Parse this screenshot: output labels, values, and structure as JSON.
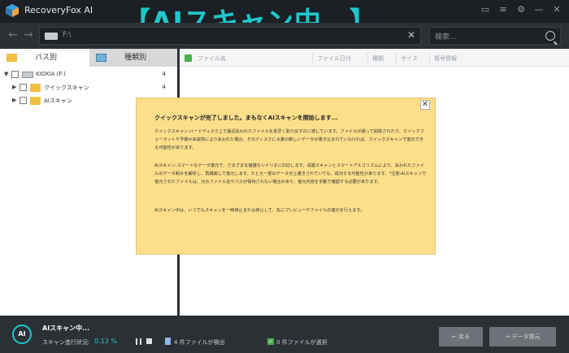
{
  "app": {
    "title": "RecoveryFox AI"
  },
  "banner": {
    "text": "【AIスキャン中…】"
  },
  "address": {
    "path": "F:\\"
  },
  "search": {
    "placeholder": "検索..."
  },
  "tabs": [
    {
      "label": "パス別"
    },
    {
      "label": "種類別"
    }
  ],
  "tree": [
    {
      "label": "KIOXIA (F:)",
      "count": "4"
    },
    {
      "label": "クイックスキャン",
      "count": "4"
    },
    {
      "label": "AIスキャン",
      "count": ""
    }
  ],
  "columns": [
    "ファイル名",
    "ファイル日付",
    "種類",
    "サイズ",
    "復号情報"
  ],
  "dialog": {
    "title": "クイックスキャンが完了しました。まもなくAIスキャンを開始します...",
    "p1": "クイックスキャン:ハードディスク上で最近失われたファイルを素早く取り戻すのに適しています。ファイルが誤って削除されたり、クイックフォーマットや予期せぬ故障により失われた場合、そのディスクに大量の新しいデータが書き込まれていなければ、クイックスキャンで復元できる可能性があります。",
    "p2": "AIスキャン:スマートなデータ復元で、さまざまな複雑なシナリオに対応します。深層スキャンとスマートアルゴリズムにより、失われたファイルのデータ断片を解析し、再構築して復元します。たとえ一部のデータが上書きされていても、成功する可能性があります。*注意:AIスキャンで復元されたファイルは、元のファイル名やパスが保持されない場合があり、復元内容を手動で確認する必要があります。",
    "p3": "AIスキャン中は、いつでもスキャンを一時停止または停止して、先にプレビューやファイルの復元を行えます。"
  },
  "status": {
    "badge": "AI",
    "title": "AIスキャン中...",
    "progress_label": "スキャン進行状況:",
    "progress_value": "0.13 %",
    "found": "4 件ファイルが検出",
    "selected": "0 件ファイルが選択"
  },
  "buttons": {
    "back": "戻る",
    "recover": "データ復元"
  },
  "colors": {
    "accent": "#1ec8cd",
    "dialog": "#fddf8a",
    "check": "#4caf50"
  }
}
